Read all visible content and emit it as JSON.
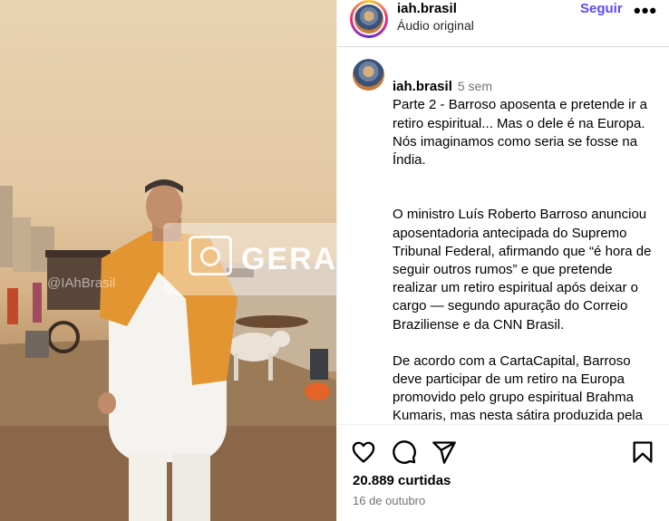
{
  "post": {
    "watermark_text": "GERADO",
    "handle_watermark": "@IAhBrasil"
  },
  "header": {
    "username": "iah.brasil",
    "audio": "Áudio original",
    "follow_label": "Seguir",
    "more_label": "•••"
  },
  "caption": {
    "username": "iah.brasil",
    "time": "5 sem",
    "paragraphs": [
      "Parte 2 - Barroso aposenta e pretende ir a retiro espiritual... Mas o dele é na Europa. Nós imaginamos como seria se fosse na Índia.",
      "O ministro Luís Roberto Barroso anunciou aposentadoria antecipada do Supremo Tribunal Federal, afirmando que “é hora de seguir outros rumos” e que pretende realizar um retiro espiritual após deixar o cargo — segundo apuração do Correio Braziliense e da CNN Brasil.",
      "De acordo com a CartaCapital, Barroso deve participar de um retiro na Europa promovido pelo grupo espiritual Brahma Kumaris, mas nesta sátira produzida pela IAh Brasil, o destino dele é bem mais exótico: a Índia."
    ]
  },
  "actions": {
    "icons": [
      "heart-icon",
      "comment-icon",
      "share-icon",
      "bookmark-icon"
    ],
    "likes": "20.889 curtidas",
    "date": "16 de outubro"
  }
}
